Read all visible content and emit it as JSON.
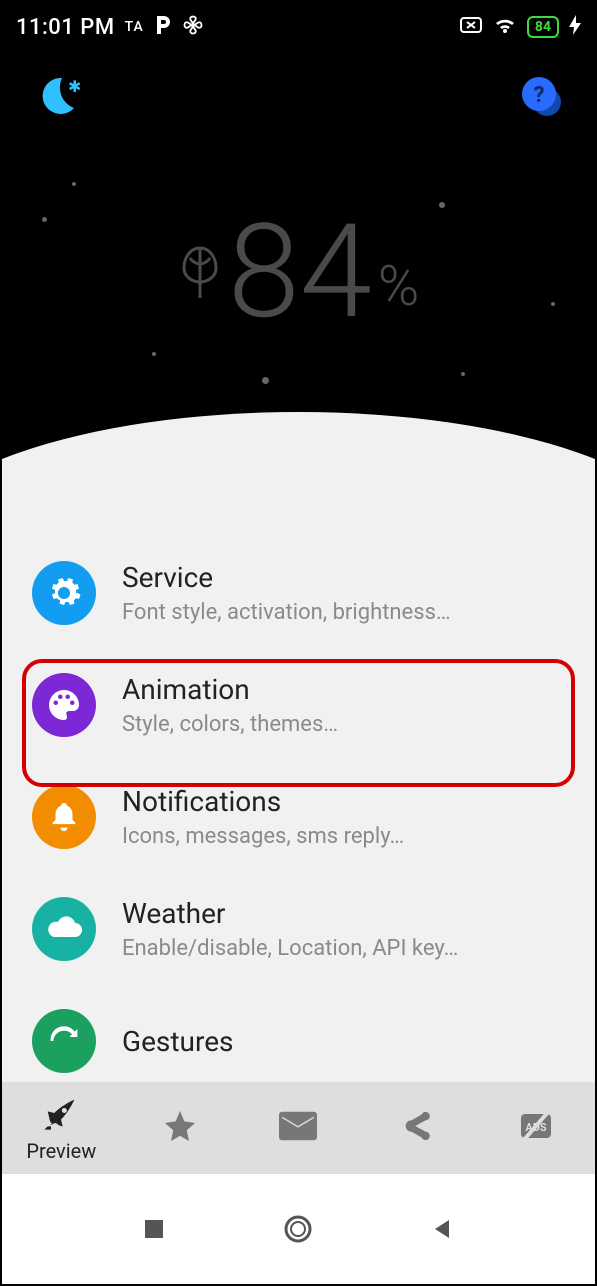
{
  "statusbar": {
    "time": "11:01 PM",
    "ta": "TA",
    "battery_text": "84"
  },
  "header": {
    "battery_value": "84",
    "battery_unit": "%"
  },
  "list": [
    {
      "id": "service",
      "title": "Service",
      "desc": "Font style, activation, brightness…",
      "color": "#129df0",
      "icon": "gear"
    },
    {
      "id": "animation",
      "title": "Animation",
      "desc": "Style, colors, themes…",
      "color": "#7c28d6",
      "icon": "palette",
      "highlight": true
    },
    {
      "id": "notifications",
      "title": "Notifications",
      "desc": "Icons, messages, sms reply…",
      "color": "#f28c00",
      "icon": "bell"
    },
    {
      "id": "weather",
      "title": "Weather",
      "desc": "Enable/disable, Location, API key…",
      "color": "#17b2a3",
      "icon": "cloud"
    },
    {
      "id": "gestures",
      "title": "Gestures",
      "desc": "",
      "color": "#1ba060",
      "icon": "swipe"
    }
  ],
  "tabs": {
    "preview": "Preview"
  },
  "colors": {
    "accent_moon": "#2fc0ff",
    "accent_help": "#2a6bff",
    "highlight": "#d40000"
  }
}
